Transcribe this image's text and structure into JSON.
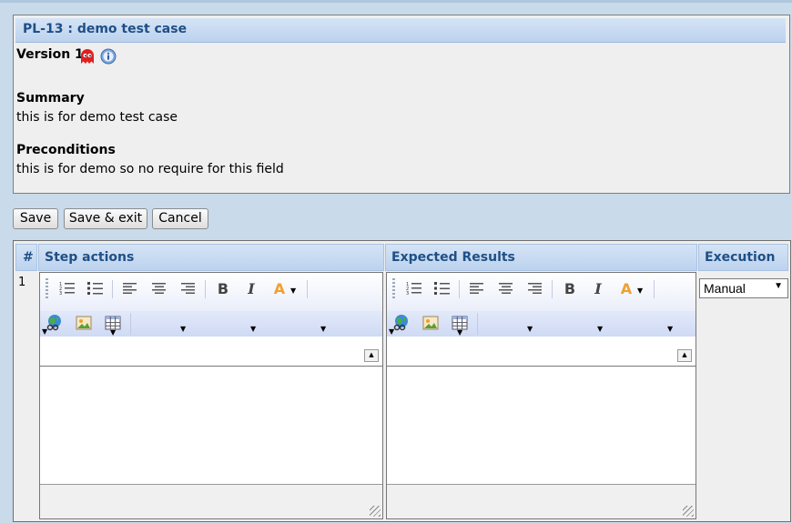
{
  "testcase": {
    "title": "PL-13 : demo test case",
    "version_label": "Version 1",
    "summary_label": "Summary",
    "summary_text": "this is for demo test case",
    "preconditions_label": "Preconditions",
    "preconditions_text": "this is for demo so no require for this field"
  },
  "buttons": {
    "save": "Save",
    "save_exit": "Save & exit",
    "cancel": "Cancel"
  },
  "table": {
    "col_num": "#",
    "col_step_actions": "Step actions",
    "col_expected": "Expected Results",
    "col_execution": "Execution",
    "row_number": "1",
    "execution_value": "Manual"
  },
  "editor_toolbar_icons": [
    "numbered-list-icon",
    "bulleted-list-icon",
    "align-left-icon",
    "align-center-icon",
    "align-right-icon",
    "bold-icon",
    "italic-icon",
    "text-color-icon",
    "link-globe-icon",
    "image-icon",
    "table-icon"
  ],
  "colors": {
    "header_text": "#1f4f86",
    "background": "#c9daea",
    "header_gradient_top": "#d5e4f6",
    "header_gradient_bottom": "#bcd2ee"
  }
}
